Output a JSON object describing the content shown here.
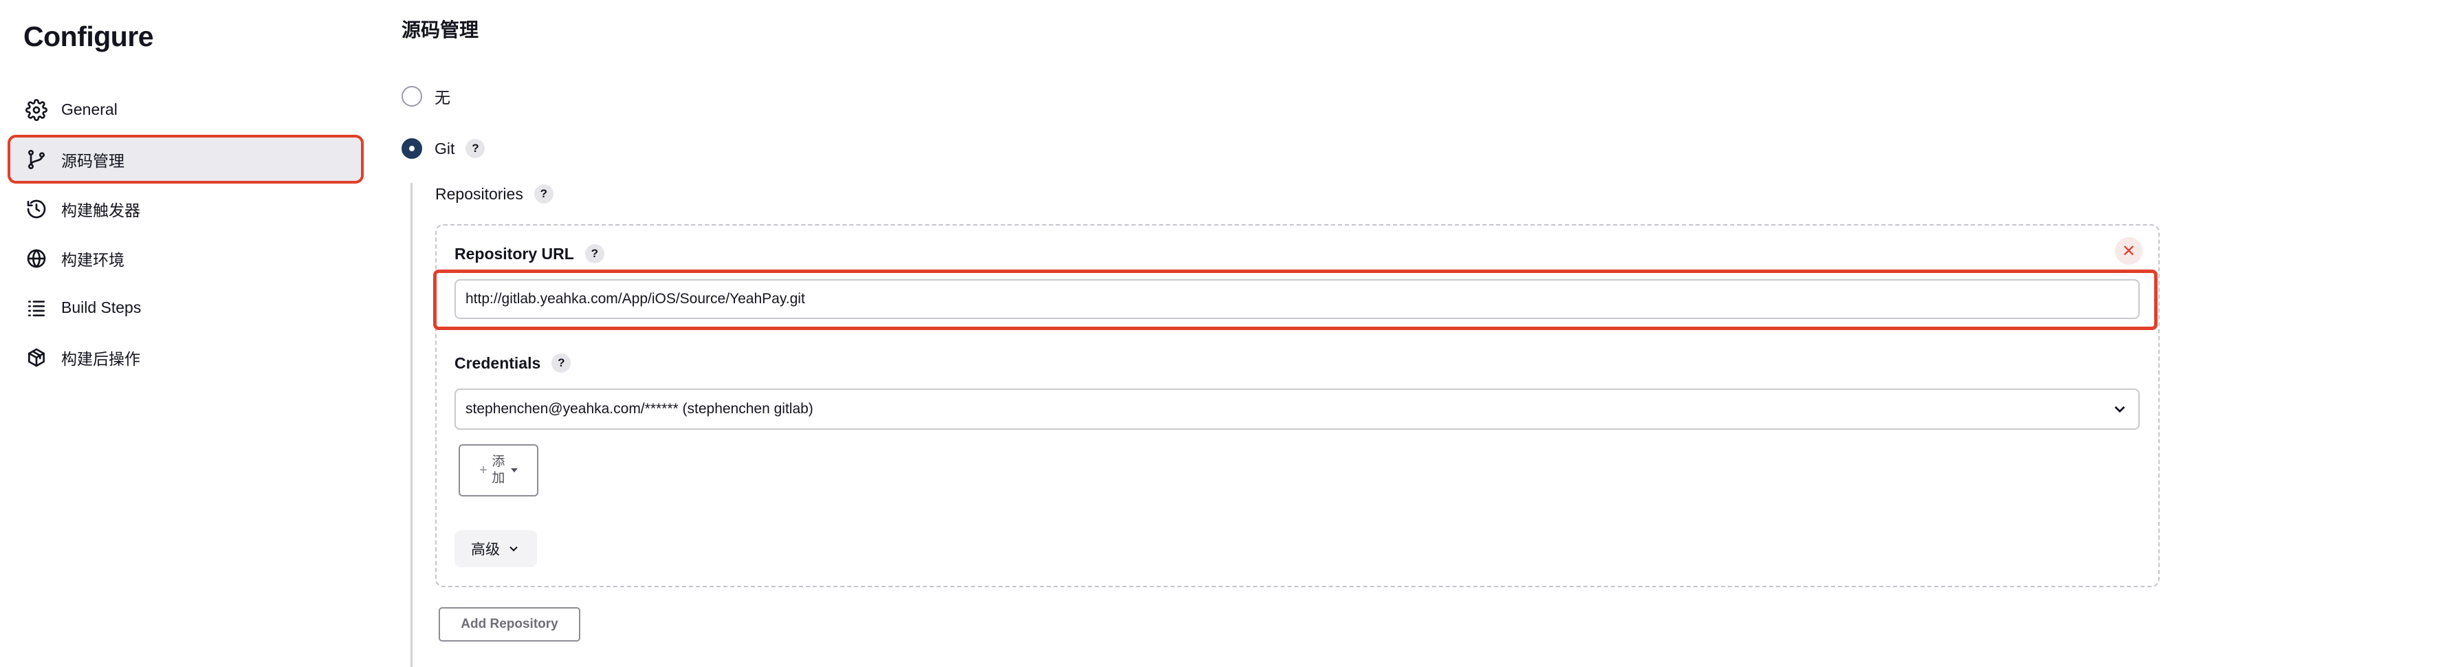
{
  "page": {
    "heading": "Configure"
  },
  "sidebar": {
    "items": [
      {
        "label": "General",
        "icon": "gear-icon"
      },
      {
        "label": "源码管理",
        "icon": "branch-icon",
        "active": true
      },
      {
        "label": "构建触发器",
        "icon": "clock-icon"
      },
      {
        "label": "构建环境",
        "icon": "globe-icon"
      },
      {
        "label": "Build Steps",
        "icon": "list-icon"
      },
      {
        "label": "构建后操作",
        "icon": "package-icon"
      }
    ]
  },
  "scm": {
    "title": "源码管理",
    "options": [
      {
        "label": "无",
        "selected": false
      },
      {
        "label": "Git",
        "selected": true,
        "help": "?"
      }
    ],
    "repositories_label": "Repositories",
    "repositories_help": "?",
    "repository": {
      "url_label": "Repository URL",
      "url_help": "?",
      "url_value": "http://gitlab.yeahka.com/App/iOS/Source/YeahPay.git",
      "remove_glyph": "✕",
      "credentials_label": "Credentials",
      "credentials_help": "?",
      "credentials_value": "stephenchen@yeahka.com/****** (stephenchen gitlab)",
      "add_plus": "+",
      "add_label": "添加",
      "advanced_label": "高级"
    },
    "add_repository_label": "Add Repository"
  },
  "colors": {
    "highlight": "#e0402a",
    "radio_selected": "#1f3a5c",
    "active_bg": "#eaeaef"
  }
}
